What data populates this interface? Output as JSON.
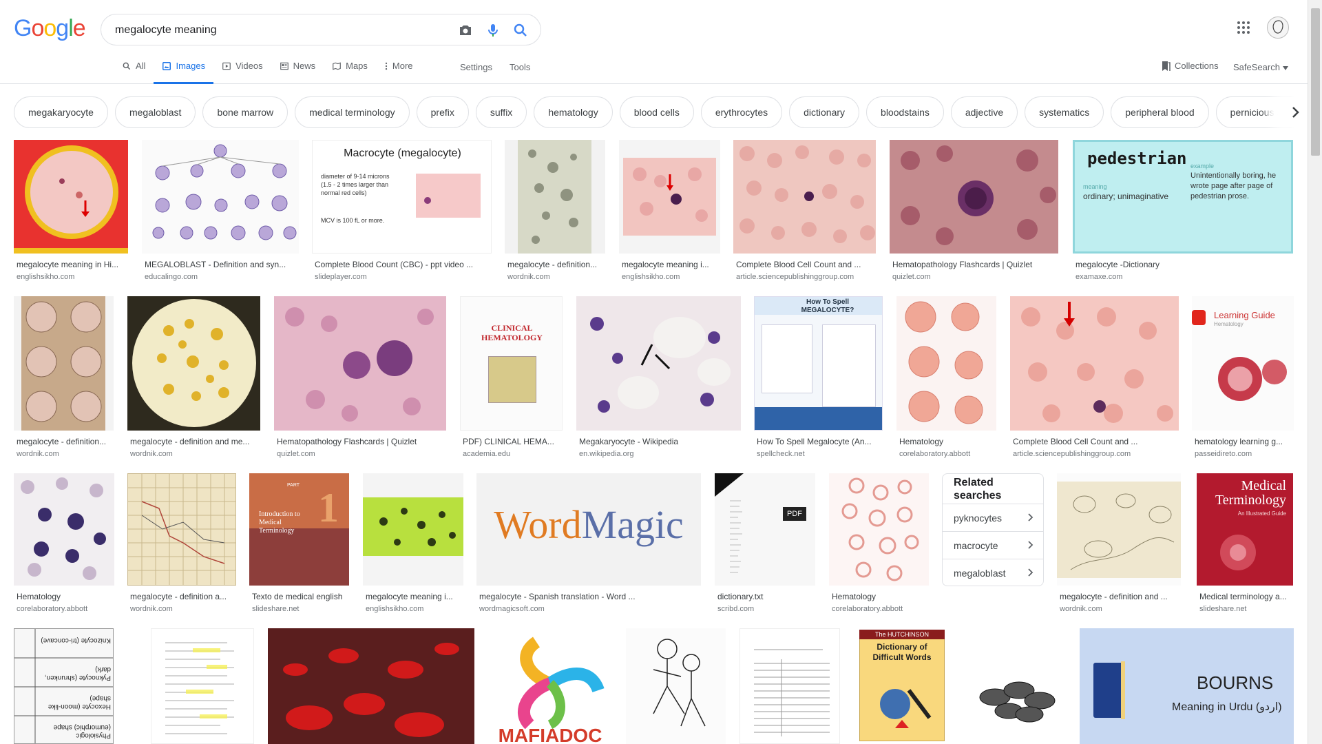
{
  "logo": {
    "letters": [
      "G",
      "o",
      "o",
      "g",
      "l",
      "e"
    ]
  },
  "search": {
    "query": "megalocyte meaning"
  },
  "tabs": [
    {
      "label": "All",
      "icon": "search-icon"
    },
    {
      "label": "Images",
      "icon": "image-icon",
      "active": true
    },
    {
      "label": "Videos",
      "icon": "video-icon"
    },
    {
      "label": "News",
      "icon": "news-icon"
    },
    {
      "label": "Maps",
      "icon": "map-icon"
    },
    {
      "label": "More",
      "icon": "more-vert-icon"
    }
  ],
  "tools": {
    "settings": "Settings",
    "tools": "Tools",
    "collections": "Collections",
    "safesearch": "SafeSearch"
  },
  "chips": [
    "megakaryocyte",
    "megaloblast",
    "bone marrow",
    "medical terminology",
    "prefix",
    "suffix",
    "hematology",
    "blood cells",
    "erythrocytes",
    "dictionary",
    "bloodstains",
    "adjective",
    "systematics",
    "peripheral blood",
    "pernicious anemia"
  ],
  "results": [
    {
      "title": "megalocyte meaning in Hi...",
      "source": "englishsikho.com"
    },
    {
      "title": "MEGALOBLAST - Definition and syn...",
      "source": "educalingo.com"
    },
    {
      "title": "Complete Blood Count (CBC) - ppt video ...",
      "source": "slideplayer.com"
    },
    {
      "title": "megalocyte - definition...",
      "source": "wordnik.com"
    },
    {
      "title": "megalocyte meaning i...",
      "source": "englishsikho.com"
    },
    {
      "title": "Complete Blood Cell Count and ...",
      "source": "article.sciencepublishinggroup.com"
    },
    {
      "title": "Hematopathology Flashcards | Quizlet",
      "source": "quizlet.com"
    },
    {
      "title": "megalocyte -Dictionary",
      "source": "examaxe.com"
    },
    {
      "title": "megalocyte - definition...",
      "source": "wordnik.com"
    },
    {
      "title": "megalocyte - definition and me...",
      "source": "wordnik.com"
    },
    {
      "title": "Hematopathology Flashcards | Quizlet",
      "source": "quizlet.com"
    },
    {
      "title": "PDF) CLINICAL HEMA...",
      "source": "academia.edu"
    },
    {
      "title": "Megakaryocyte - Wikipedia",
      "source": "en.wikipedia.org"
    },
    {
      "title": "How To Spell Megalocyte (An...",
      "source": "spellcheck.net"
    },
    {
      "title": "Hematology",
      "source": "corelaboratory.abbott"
    },
    {
      "title": "Complete Blood Cell Count and ...",
      "source": "article.sciencepublishinggroup.com"
    },
    {
      "title": "hematology learning g...",
      "source": "passeidireto.com"
    },
    {
      "title": "Hematology",
      "source": "corelaboratory.abbott"
    },
    {
      "title": "megalocyte - definition a...",
      "source": "wordnik.com"
    },
    {
      "title": "Texto de medical english",
      "source": "slideshare.net"
    },
    {
      "title": "megalocyte meaning i...",
      "source": "englishsikho.com"
    },
    {
      "title": "megalocyte - Spanish translation - Word ...",
      "source": "wordmagicsoft.com"
    },
    {
      "title": "dictionary.txt",
      "source": "scribd.com"
    },
    {
      "title": "Hematology",
      "source": "corelaboratory.abbott"
    },
    {
      "title": "megalocyte - definition and ...",
      "source": "wordnik.com"
    },
    {
      "title": "Medical terminology a...",
      "source": "slideshare.net"
    }
  ],
  "thumb_text": {
    "macrocyte_title": "Macrocyte (megalocyte)",
    "macrocyte_b1": "diameter of 9-14 microns (1.5 - 2 times larger than normal red cells)",
    "macrocyte_b2": "MCV is 100 fL or more.",
    "pedestrian_word": "pedestrian",
    "pedestrian_meaning_label": "meaning",
    "pedestrian_meaning": "ordinary; unimaginative",
    "pedestrian_example_label": "example",
    "pedestrian_example": "Unintentionally boring, he wrote page after page of pedestrian prose.",
    "clinical_hematology": "CLINICAL HEMATOLOGY",
    "spell_title": "How To Spell MEGALOCYTE?",
    "learning_guide": "Learning Guide",
    "learning_sub": "Hematology",
    "medterm_part": "PART",
    "medterm_num": "1",
    "medterm_title": "Introduction to Medical Terminology",
    "wordmagic_a": "Word",
    "wordmagic_b": "Magic",
    "pdf_badge": "PDF",
    "medical_title": "Medical Terminology",
    "medical_sub": "An Illustrated Guide",
    "mafiadoc": "MAFIADOC",
    "hutchinson_pub": "The HUTCHINSON",
    "hutchinson_title": "Dictionary of Difficult Words",
    "bourns": "BOURNS",
    "bourns_sub": "Meaning in Urdu (اردو)",
    "rotated_1": "Physiologic (eumorphic) shape",
    "rotated_2": "Hexocyte (moon-like shape)",
    "rotated_3": "Pyknocyte (shrunken, dark)",
    "rotated_4": "Knizocyte (tri-concave)"
  },
  "related": {
    "heading": "Related searches",
    "items": [
      "pyknocytes",
      "macrocyte",
      "megaloblast"
    ]
  },
  "colors": {
    "accent": "#1a73e8",
    "text_secondary": "#70757a"
  }
}
